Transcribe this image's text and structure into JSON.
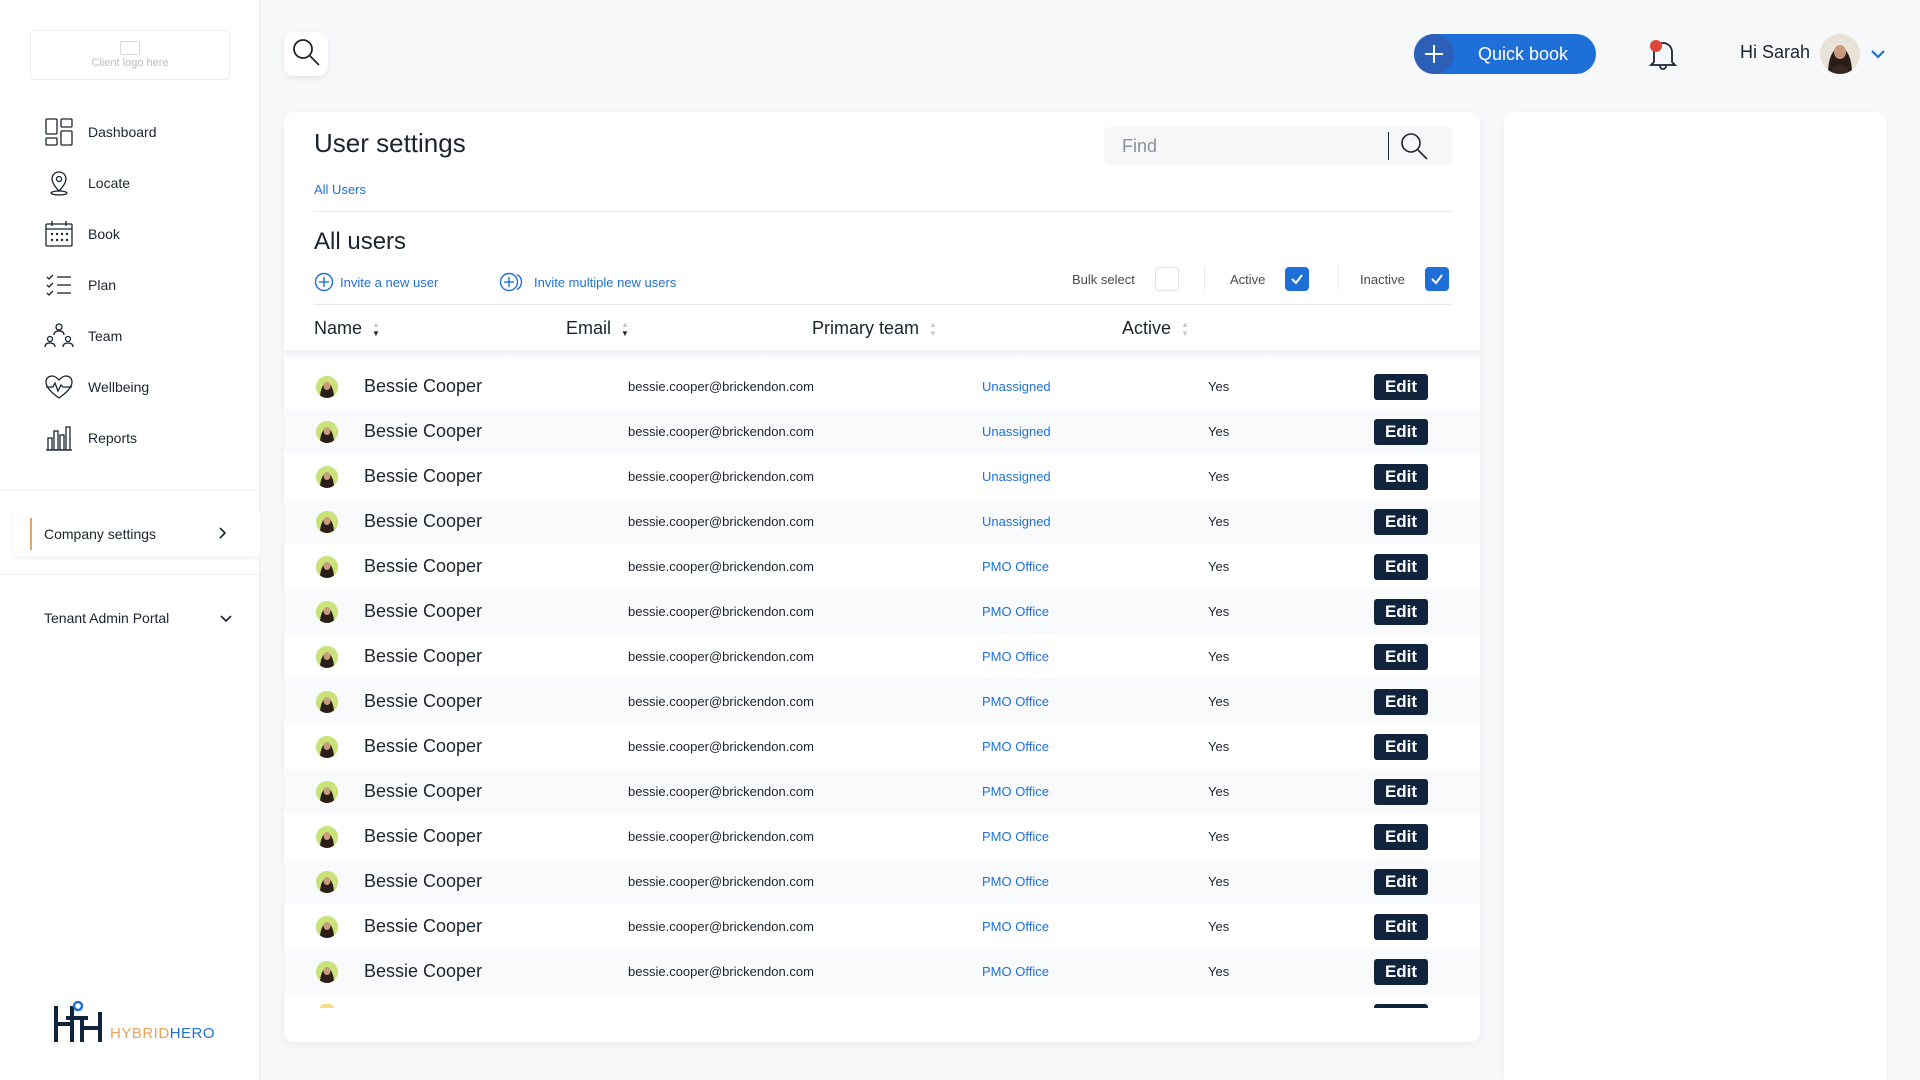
{
  "client_logo": {
    "text": "Client logo here"
  },
  "sidebar": {
    "items": [
      {
        "label": "Dashboard",
        "icon": "dashboard-icon"
      },
      {
        "label": "Locate",
        "icon": "location-pin-icon"
      },
      {
        "label": "Book",
        "icon": "calendar-icon"
      },
      {
        "label": "Plan",
        "icon": "checklist-icon"
      },
      {
        "label": "Team",
        "icon": "team-icon"
      },
      {
        "label": "Wellbeing",
        "icon": "heartbeat-icon"
      },
      {
        "label": "Reports",
        "icon": "bar-chart-icon"
      }
    ],
    "company_settings": "Company settings",
    "tenant_admin": "Tenant Admin Portal"
  },
  "brand": {
    "part1": "HYBRID",
    "part2": "HERO",
    "colors": {
      "part1": "#e8a45a",
      "part2": "#1f6fd8",
      "navy": "#10243e"
    }
  },
  "topbar": {
    "quick_book": "Quick book",
    "greeting": "Hi Sarah"
  },
  "main": {
    "title": "User settings",
    "find_placeholder": "Find",
    "breadcrumb": "All Users",
    "section_title": "All users",
    "invite_user": "Invite a new user",
    "invite_multiple": "Invite multiple new users",
    "filters": {
      "bulk_select": "Bulk select",
      "bulk_select_checked": false,
      "active": "Active",
      "active_checked": true,
      "inactive": "Inactive",
      "inactive_checked": true
    },
    "columns": [
      "Name",
      "Email",
      "Primary team",
      "Active"
    ],
    "edit_label": "Edit",
    "rows": [
      {
        "name": "Bessie Cooper",
        "email": "bessie.cooper@brickendon.com",
        "team": "Unassigned",
        "active": "Yes"
      },
      {
        "name": "Bessie Cooper",
        "email": "bessie.cooper@brickendon.com",
        "team": "Unassigned",
        "active": "Yes"
      },
      {
        "name": "Bessie Cooper",
        "email": "bessie.cooper@brickendon.com",
        "team": "Unassigned",
        "active": "Yes"
      },
      {
        "name": "Bessie Cooper",
        "email": "bessie.cooper@brickendon.com",
        "team": "Unassigned",
        "active": "Yes"
      },
      {
        "name": "Bessie Cooper",
        "email": "bessie.cooper@brickendon.com",
        "team": "PMO Office",
        "active": "Yes"
      },
      {
        "name": "Bessie Cooper",
        "email": "bessie.cooper@brickendon.com",
        "team": "PMO Office",
        "active": "Yes"
      },
      {
        "name": "Bessie Cooper",
        "email": "bessie.cooper@brickendon.com",
        "team": "PMO Office",
        "active": "Yes"
      },
      {
        "name": "Bessie Cooper",
        "email": "bessie.cooper@brickendon.com",
        "team": "PMO Office",
        "active": "Yes"
      },
      {
        "name": "Bessie Cooper",
        "email": "bessie.cooper@brickendon.com",
        "team": "PMO Office",
        "active": "Yes"
      },
      {
        "name": "Bessie Cooper",
        "email": "bessie.cooper@brickendon.com",
        "team": "PMO Office",
        "active": "Yes"
      },
      {
        "name": "Bessie Cooper",
        "email": "bessie.cooper@brickendon.com",
        "team": "PMO Office",
        "active": "Yes"
      },
      {
        "name": "Bessie Cooper",
        "email": "bessie.cooper@brickendon.com",
        "team": "PMO Office",
        "active": "Yes"
      },
      {
        "name": "Bessie Cooper",
        "email": "bessie.cooper@brickendon.com",
        "team": "PMO Office",
        "active": "Yes"
      },
      {
        "name": "Bessie Cooper",
        "email": "bessie.cooper@brickendon.com",
        "team": "PMO Office",
        "active": "Yes"
      }
    ]
  },
  "colors": {
    "accent": "#1f6fd8",
    "navy": "#10243e",
    "notification": "#e0453c",
    "highlight": "#e8a45a"
  }
}
